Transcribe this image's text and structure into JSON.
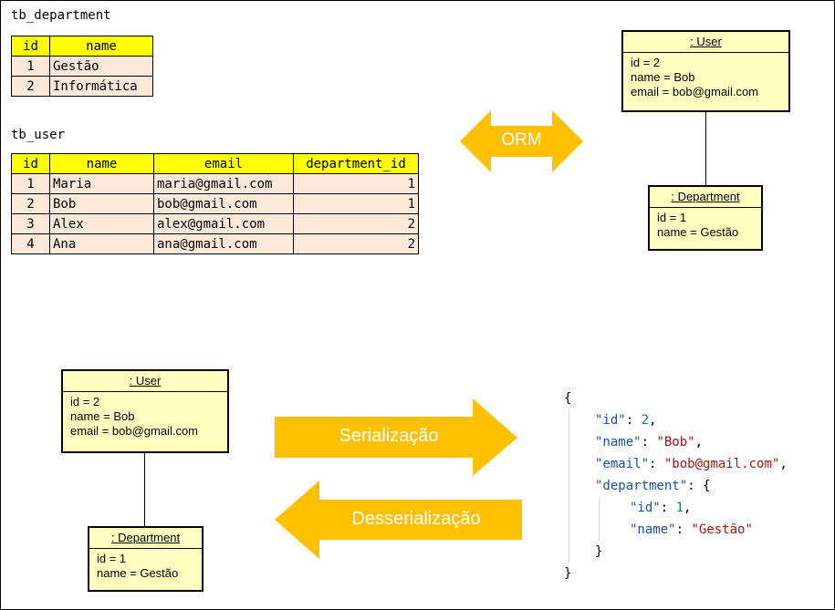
{
  "tb_department": {
    "caption": "tb_department",
    "headers": [
      "id",
      "name"
    ],
    "rows": [
      [
        "1",
        "Gestão"
      ],
      [
        "2",
        "Informática"
      ]
    ]
  },
  "tb_user": {
    "caption": "tb_user",
    "headers": [
      "id",
      "name",
      "email",
      "department_id"
    ],
    "rows": [
      [
        "1",
        "Maria",
        "maria@gmail.com",
        "1"
      ],
      [
        "2",
        "Bob",
        "bob@gmail.com",
        "1"
      ],
      [
        "3",
        "Alex",
        "alex@gmail.com",
        "2"
      ],
      [
        "4",
        "Ana",
        "ana@gmail.com",
        "2"
      ]
    ]
  },
  "orm": {
    "label": "ORM"
  },
  "user_object": {
    "title": ": User",
    "fields": [
      "id = 2",
      "name = Bob",
      "email = bob@gmail.com"
    ]
  },
  "department_object": {
    "title": ": Department",
    "fields": [
      "id = 1",
      "name = Gestão"
    ]
  },
  "serialization": {
    "label": "Serialização"
  },
  "deserialization": {
    "label": "Desserialização"
  },
  "json": {
    "open": "{",
    "id_key": "\"id\"",
    "id_val": "2",
    "name_key": "\"name\"",
    "name_val": "\"Bob\"",
    "email_key": "\"email\"",
    "email_val": "\"bob@gmail.com\"",
    "dept_key": "\"department\"",
    "dept_open": "{",
    "dept_id_key": "\"id\"",
    "dept_id_val": "1",
    "dept_name_key": "\"name\"",
    "dept_name_val": "\"Gestão\"",
    "dept_close": "}",
    "close": "}"
  },
  "colors": {
    "arrow": "#ffc000",
    "table_header": "#ffff00",
    "table_cell": "#fde9d9",
    "object_fill": "#ffffc0"
  }
}
